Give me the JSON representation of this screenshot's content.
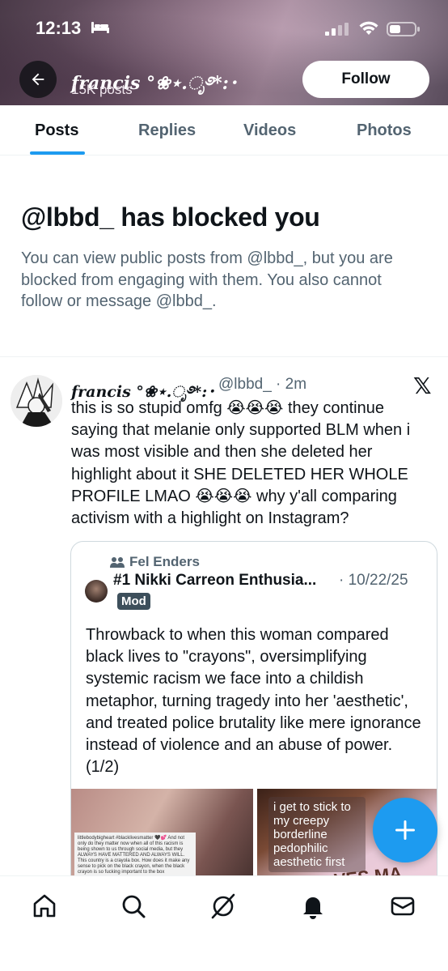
{
  "status_bar": {
    "time": "12:13"
  },
  "profile_header": {
    "name": "francis °❀⋆.ೃ࿔*:･",
    "post_count": "15K posts",
    "follow_label": "Follow"
  },
  "tabs": [
    {
      "label": "Posts",
      "active": true
    },
    {
      "label": "Replies",
      "active": false
    },
    {
      "label": "Videos",
      "active": false
    },
    {
      "label": "Photos",
      "active": false
    }
  ],
  "blocked_notice": {
    "title": "@lbbd_ has blocked you",
    "description": "You can view public posts from @lbbd_, but you are blocked from engaging with them. You also cannot follow or message @lbbd_."
  },
  "tweet": {
    "author_name": "francis °❀⋆.ೃ࿔*:･",
    "handle_time": "@lbbd_ · 2m",
    "text": "this is so stupid omfg 😭😭😭 they continue saying that melanie only supported BLM when i was most visible and then she deleted her highlight about it SHE DELETED HER WHOLE PROFILE LMAO 😭😭😭 why y'all comparing activism with a highlight on Instagram?",
    "quote": {
      "community": "Fel Enders",
      "author": "#1 Nikki Carreon Enthusia...",
      "date": "· 10/22/25",
      "badge": "Mod",
      "text": "Throwback to when this woman compared black lives to \"crayons\", oversimplifying systemic racism we face into a childish metaphor, turning tragedy into her 'aesthetic', and treated police brutality like mere ignorance instead of violence and an abuse of power. (1/2)",
      "image1_text": "littlebodybigheart #blacklivesmatter 🖤💕 And not only do they matter now when all of this racism is being shown to us through social media, but they ALWAYS HAVE MATTERED AND ALWAYS WILL. This country is a crayola box. How does it make any sense to pick on the black crayon, when the black crayon is so fucking important to the box",
      "image2_caption": "i get to stick to\nmy creepy\nborderline\npedophilic\naesthetic first",
      "image2_lettering": "VES MA"
    }
  },
  "fab": {
    "icon": "plus-icon"
  },
  "bottom_nav": [
    "home-icon",
    "search-icon",
    "grok-icon",
    "notifications-icon",
    "messages-icon"
  ],
  "colors": {
    "accent": "#1d9bf0",
    "text": "#0f1419",
    "muted": "#536471"
  }
}
